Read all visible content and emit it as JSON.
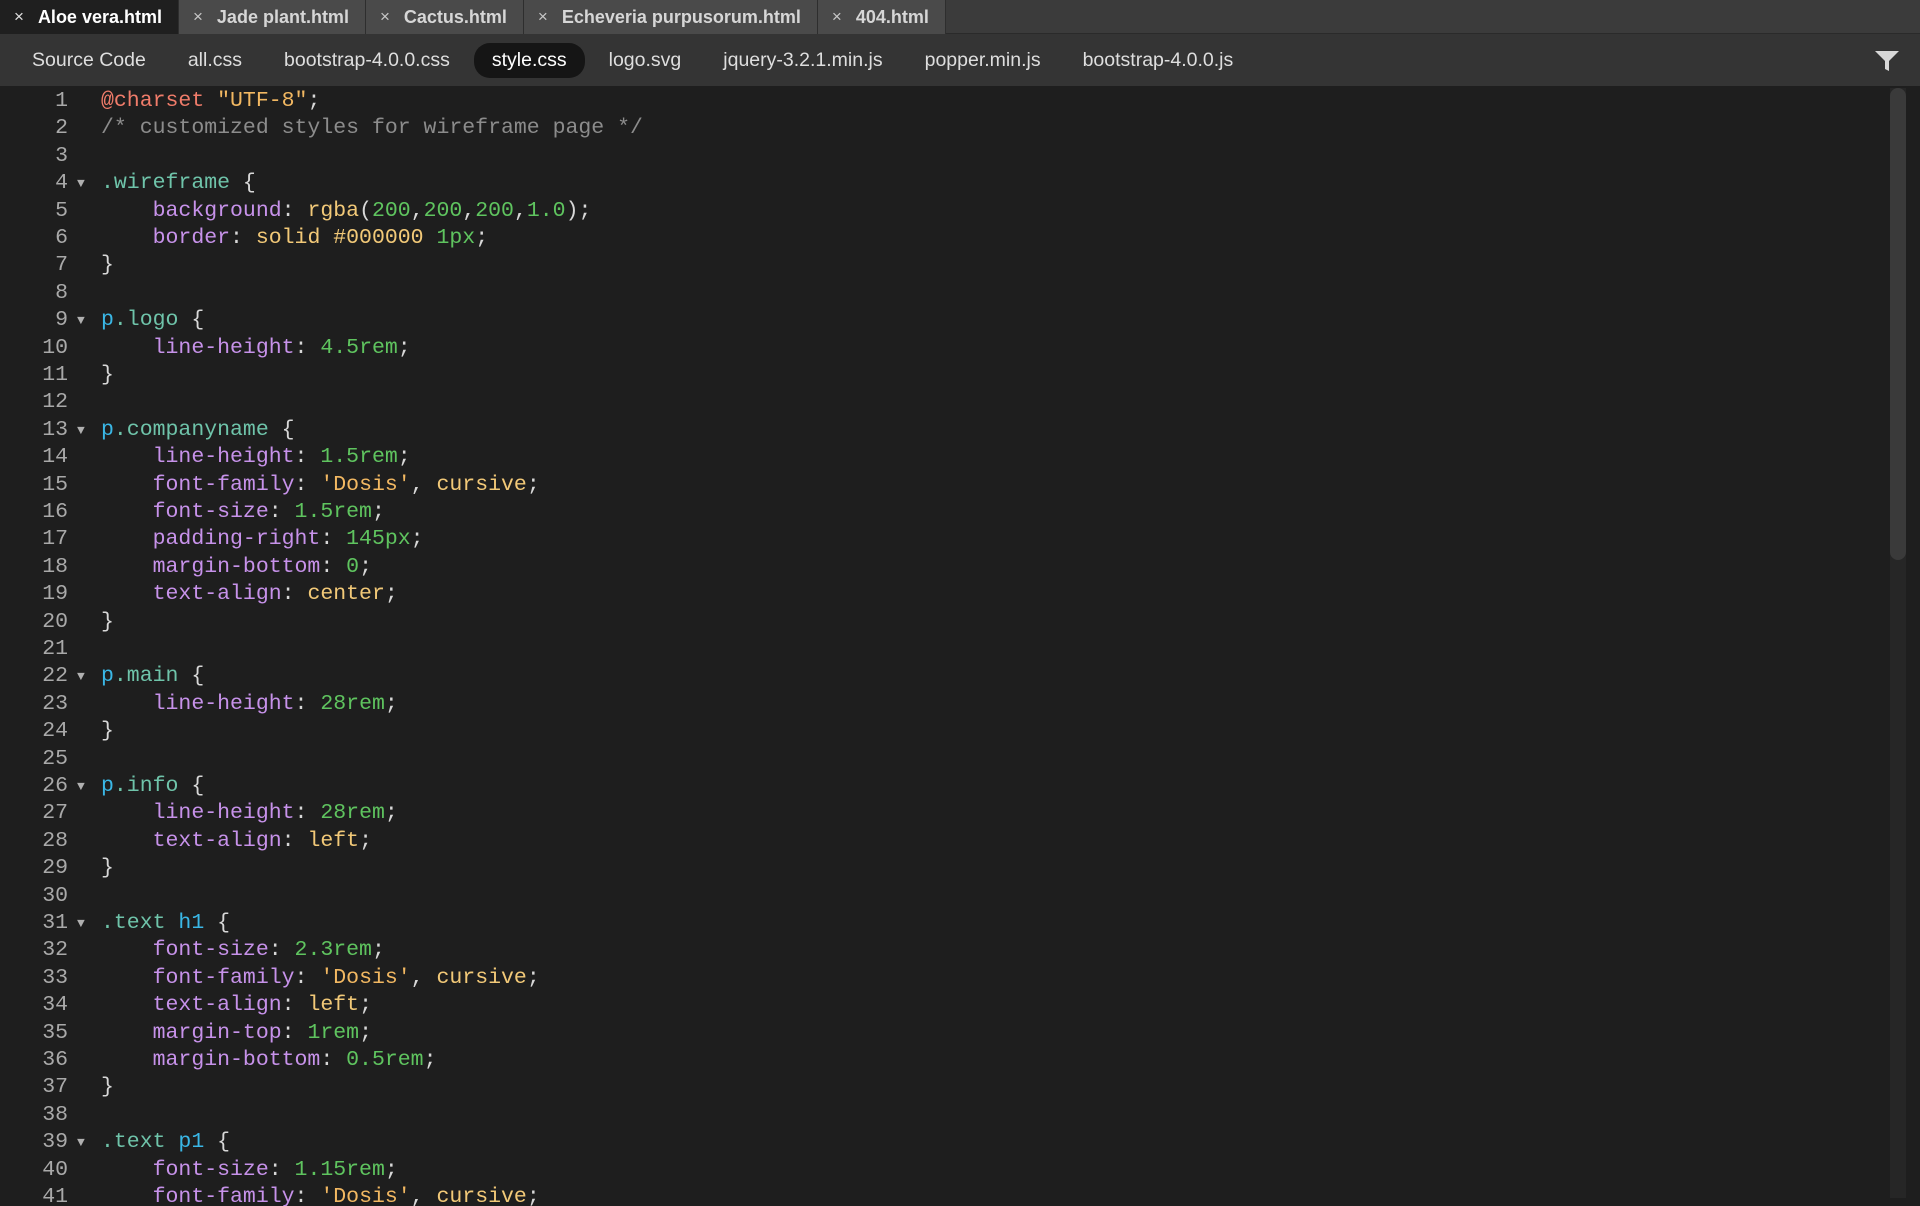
{
  "doc_tabs": [
    {
      "label": "Aloe vera.html",
      "close": "×",
      "active": true
    },
    {
      "label": "Jade plant.html",
      "close": "×",
      "active": false
    },
    {
      "label": "Cactus.html",
      "close": "×",
      "active": false
    },
    {
      "label": "Echeveria purpusorum.html",
      "close": "×",
      "active": false
    },
    {
      "label": "404.html",
      "close": "×",
      "active": false
    }
  ],
  "related_files": [
    {
      "label": "Source Code",
      "active": false
    },
    {
      "label": "all.css",
      "active": false
    },
    {
      "label": "bootstrap-4.0.0.css",
      "active": false
    },
    {
      "label": "style.css",
      "active": true
    },
    {
      "label": "logo.svg",
      "active": false
    },
    {
      "label": "jquery-3.2.1.min.js",
      "active": false
    },
    {
      "label": "popper.min.js",
      "active": false
    },
    {
      "label": "bootstrap-4.0.0.js",
      "active": false
    }
  ],
  "filter_icon": "filter-icon",
  "fold_glyph": "▼",
  "code_lines": [
    {
      "n": "1",
      "fold": false,
      "tokens": [
        [
          "at",
          "@charset"
        ],
        [
          "pl",
          " "
        ],
        [
          "str",
          "\"UTF-8\""
        ],
        [
          "pl",
          ";"
        ]
      ]
    },
    {
      "n": "2",
      "fold": false,
      "tokens": [
        [
          "com",
          "/* customized styles for wireframe page */"
        ]
      ]
    },
    {
      "n": "3",
      "fold": false,
      "tokens": []
    },
    {
      "n": "4",
      "fold": true,
      "tokens": [
        [
          "sel",
          ".wireframe"
        ],
        [
          "pl",
          " {"
        ]
      ]
    },
    {
      "n": "5",
      "fold": false,
      "tokens": [
        [
          "pl",
          "    "
        ],
        [
          "prop",
          "background"
        ],
        [
          "pl",
          ": "
        ],
        [
          "kw",
          "rgba"
        ],
        [
          "pl",
          "("
        ],
        [
          "num",
          "200"
        ],
        [
          "pl",
          ","
        ],
        [
          "num",
          "200"
        ],
        [
          "pl",
          ","
        ],
        [
          "num",
          "200"
        ],
        [
          "pl",
          ","
        ],
        [
          "num",
          "1.0"
        ],
        [
          "pl",
          ");"
        ]
      ]
    },
    {
      "n": "6",
      "fold": false,
      "tokens": [
        [
          "pl",
          "    "
        ],
        [
          "prop",
          "border"
        ],
        [
          "pl",
          ": "
        ],
        [
          "kw",
          "solid #000000"
        ],
        [
          "pl",
          " "
        ],
        [
          "num",
          "1px"
        ],
        [
          "pl",
          ";"
        ]
      ]
    },
    {
      "n": "7",
      "fold": false,
      "tokens": [
        [
          "pl",
          "}"
        ]
      ]
    },
    {
      "n": "8",
      "fold": false,
      "tokens": []
    },
    {
      "n": "9",
      "fold": true,
      "tokens": [
        [
          "tag",
          "p"
        ],
        [
          "sel",
          ".logo"
        ],
        [
          "pl",
          " {"
        ]
      ]
    },
    {
      "n": "10",
      "fold": false,
      "tokens": [
        [
          "pl",
          "    "
        ],
        [
          "prop",
          "line-height"
        ],
        [
          "pl",
          ": "
        ],
        [
          "num",
          "4.5rem"
        ],
        [
          "pl",
          ";"
        ]
      ]
    },
    {
      "n": "11",
      "fold": false,
      "tokens": [
        [
          "pl",
          "}"
        ]
      ]
    },
    {
      "n": "12",
      "fold": false,
      "tokens": []
    },
    {
      "n": "13",
      "fold": true,
      "tokens": [
        [
          "tag",
          "p"
        ],
        [
          "sel",
          ".companyname"
        ],
        [
          "pl",
          " {"
        ]
      ]
    },
    {
      "n": "14",
      "fold": false,
      "tokens": [
        [
          "pl",
          "    "
        ],
        [
          "prop",
          "line-height"
        ],
        [
          "pl",
          ": "
        ],
        [
          "num",
          "1.5rem"
        ],
        [
          "pl",
          ";"
        ]
      ]
    },
    {
      "n": "15",
      "fold": false,
      "tokens": [
        [
          "pl",
          "    "
        ],
        [
          "prop",
          "font-family"
        ],
        [
          "pl",
          ": "
        ],
        [
          "str",
          "'Dosis'"
        ],
        [
          "pl",
          ", "
        ],
        [
          "kw",
          "cursive"
        ],
        [
          "pl",
          ";"
        ]
      ]
    },
    {
      "n": "16",
      "fold": false,
      "tokens": [
        [
          "pl",
          "    "
        ],
        [
          "prop",
          "font-size"
        ],
        [
          "pl",
          ": "
        ],
        [
          "num",
          "1.5rem"
        ],
        [
          "pl",
          ";"
        ]
      ]
    },
    {
      "n": "17",
      "fold": false,
      "tokens": [
        [
          "pl",
          "    "
        ],
        [
          "prop",
          "padding-right"
        ],
        [
          "pl",
          ": "
        ],
        [
          "num",
          "145px"
        ],
        [
          "pl",
          ";"
        ]
      ]
    },
    {
      "n": "18",
      "fold": false,
      "tokens": [
        [
          "pl",
          "    "
        ],
        [
          "prop",
          "margin-bottom"
        ],
        [
          "pl",
          ": "
        ],
        [
          "num",
          "0"
        ],
        [
          "pl",
          ";"
        ]
      ]
    },
    {
      "n": "19",
      "fold": false,
      "tokens": [
        [
          "pl",
          "    "
        ],
        [
          "prop",
          "text-align"
        ],
        [
          "pl",
          ": "
        ],
        [
          "kw",
          "center"
        ],
        [
          "pl",
          ";"
        ]
      ]
    },
    {
      "n": "20",
      "fold": false,
      "tokens": [
        [
          "pl",
          "}"
        ]
      ]
    },
    {
      "n": "21",
      "fold": false,
      "tokens": []
    },
    {
      "n": "22",
      "fold": true,
      "tokens": [
        [
          "tag",
          "p"
        ],
        [
          "sel",
          ".main"
        ],
        [
          "pl",
          " {"
        ]
      ]
    },
    {
      "n": "23",
      "fold": false,
      "tokens": [
        [
          "pl",
          "    "
        ],
        [
          "prop",
          "line-height"
        ],
        [
          "pl",
          ": "
        ],
        [
          "num",
          "28rem"
        ],
        [
          "pl",
          ";"
        ]
      ]
    },
    {
      "n": "24",
      "fold": false,
      "tokens": [
        [
          "pl",
          "}"
        ]
      ]
    },
    {
      "n": "25",
      "fold": false,
      "tokens": []
    },
    {
      "n": "26",
      "fold": true,
      "tokens": [
        [
          "tag",
          "p"
        ],
        [
          "sel",
          ".info"
        ],
        [
          "pl",
          " {"
        ]
      ]
    },
    {
      "n": "27",
      "fold": false,
      "tokens": [
        [
          "pl",
          "    "
        ],
        [
          "prop",
          "line-height"
        ],
        [
          "pl",
          ": "
        ],
        [
          "num",
          "28rem"
        ],
        [
          "pl",
          ";"
        ]
      ]
    },
    {
      "n": "28",
      "fold": false,
      "tokens": [
        [
          "pl",
          "    "
        ],
        [
          "prop",
          "text-align"
        ],
        [
          "pl",
          ": "
        ],
        [
          "kw",
          "left"
        ],
        [
          "pl",
          ";"
        ]
      ]
    },
    {
      "n": "29",
      "fold": false,
      "tokens": [
        [
          "pl",
          "}"
        ]
      ]
    },
    {
      "n": "30",
      "fold": false,
      "tokens": []
    },
    {
      "n": "31",
      "fold": true,
      "tokens": [
        [
          "sel",
          ".text"
        ],
        [
          "pl",
          " "
        ],
        [
          "tag",
          "h1"
        ],
        [
          "pl",
          " {"
        ]
      ]
    },
    {
      "n": "32",
      "fold": false,
      "tokens": [
        [
          "pl",
          "    "
        ],
        [
          "prop",
          "font-size"
        ],
        [
          "pl",
          ": "
        ],
        [
          "num",
          "2.3rem"
        ],
        [
          "pl",
          ";"
        ]
      ]
    },
    {
      "n": "33",
      "fold": false,
      "tokens": [
        [
          "pl",
          "    "
        ],
        [
          "prop",
          "font-family"
        ],
        [
          "pl",
          ": "
        ],
        [
          "str",
          "'Dosis'"
        ],
        [
          "pl",
          ", "
        ],
        [
          "kw",
          "cursive"
        ],
        [
          "pl",
          ";"
        ]
      ]
    },
    {
      "n": "34",
      "fold": false,
      "tokens": [
        [
          "pl",
          "    "
        ],
        [
          "prop",
          "text-align"
        ],
        [
          "pl",
          ": "
        ],
        [
          "kw",
          "left"
        ],
        [
          "pl",
          ";"
        ]
      ]
    },
    {
      "n": "35",
      "fold": false,
      "tokens": [
        [
          "pl",
          "    "
        ],
        [
          "prop",
          "margin-top"
        ],
        [
          "pl",
          ": "
        ],
        [
          "num",
          "1rem"
        ],
        [
          "pl",
          ";"
        ]
      ]
    },
    {
      "n": "36",
      "fold": false,
      "tokens": [
        [
          "pl",
          "    "
        ],
        [
          "prop",
          "margin-bottom"
        ],
        [
          "pl",
          ": "
        ],
        [
          "num",
          "0.5rem"
        ],
        [
          "pl",
          ";"
        ]
      ]
    },
    {
      "n": "37",
      "fold": false,
      "tokens": [
        [
          "pl",
          "}"
        ]
      ]
    },
    {
      "n": "38",
      "fold": false,
      "tokens": []
    },
    {
      "n": "39",
      "fold": true,
      "tokens": [
        [
          "sel",
          ".text"
        ],
        [
          "pl",
          " "
        ],
        [
          "tag",
          "p1"
        ],
        [
          "pl",
          " {"
        ]
      ]
    },
    {
      "n": "40",
      "fold": false,
      "tokens": [
        [
          "pl",
          "    "
        ],
        [
          "prop",
          "font-size"
        ],
        [
          "pl",
          ": "
        ],
        [
          "num",
          "1.15rem"
        ],
        [
          "pl",
          ";"
        ]
      ]
    },
    {
      "n": "41",
      "fold": false,
      "tokens": [
        [
          "pl",
          "    "
        ],
        [
          "prop",
          "font-family"
        ],
        [
          "pl",
          ": "
        ],
        [
          "str",
          "'Dosis'"
        ],
        [
          "pl",
          ", "
        ],
        [
          "kw",
          "cursive"
        ],
        [
          "pl",
          ";"
        ]
      ]
    }
  ]
}
